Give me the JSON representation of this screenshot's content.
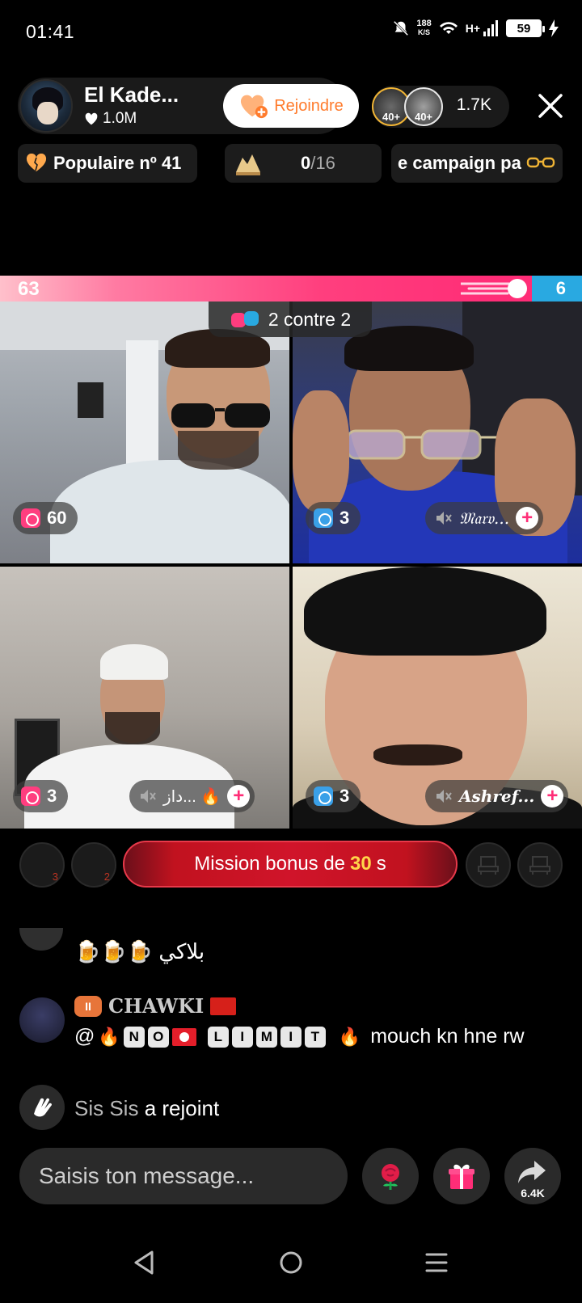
{
  "status_bar": {
    "time": "01:41",
    "net_speed_value": "188",
    "net_speed_unit": "K/S",
    "network": "H+",
    "battery": "59"
  },
  "host": {
    "name": "El Kade...",
    "likes": "1.0M",
    "join_label": "Rejoindre"
  },
  "viewers": {
    "badge1": "40+",
    "badge2": "40+",
    "count": "1.7K"
  },
  "chips": {
    "popular": "Populaire nº 41",
    "goal_value": "0",
    "goal_total": "/16",
    "campaign": "e campaign pa"
  },
  "battle": {
    "score_left": "63",
    "score_right": "6",
    "mode": "2 contre 2"
  },
  "participants": [
    {
      "score": "60",
      "team": "pink",
      "name": ""
    },
    {
      "score": "3",
      "team": "blue",
      "name": "𝔐𝔞𝔯𝔳..."
    },
    {
      "score": "3",
      "team": "pink",
      "name": "داز... 🔥"
    },
    {
      "score": "3",
      "team": "blue",
      "name": "Ashref..."
    }
  ],
  "mission": {
    "prefix": "Mission bonus de",
    "seconds": "30",
    "suffix": "s",
    "seat1_num": "3",
    "seat2_num": "2"
  },
  "chat": {
    "msg1_text": "بلاكي 🍺🍺🍺",
    "msg2_user": "CHAWKI",
    "msg2_level": "II",
    "msg2_letters1": [
      "N",
      "O"
    ],
    "msg2_letters2": [
      "L",
      "I",
      "M",
      "I",
      "T"
    ],
    "msg2_tail": "mouch kn hne rw",
    "msg3_name": "Sis Sis",
    "msg3_action": "a rejoint"
  },
  "input": {
    "placeholder": "Saisis ton message..."
  },
  "actions": {
    "share_count": "6.4K"
  },
  "colors": {
    "join_orange": "#ff7b2c",
    "battle_pink": "#ff2d77",
    "battle_blue": "#29a9e1",
    "mission_red": "#c1121f",
    "mission_gold": "#ffd54a"
  }
}
